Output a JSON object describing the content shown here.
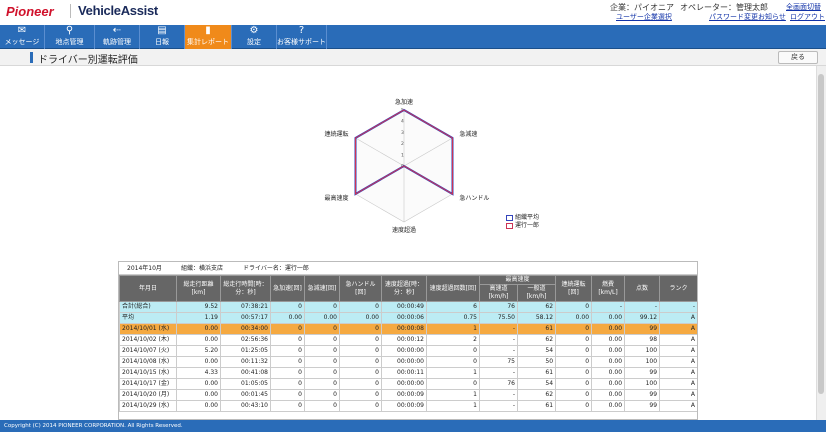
{
  "header": {
    "logo_pioneer": "Pioneer",
    "logo_vehicle": "VehicleAssist",
    "company_label": "企業：パイオニア",
    "operator_label": "オペレーター：管理太郎",
    "links": {
      "switch_user_company": "ユーザー企業選択",
      "change_password": "パスワード変更",
      "fullscreen_toggle": "全画面切替",
      "notices": "お知らせ",
      "logout": "ログアウト"
    }
  },
  "nav": {
    "items": [
      {
        "label": "メッセージ",
        "icon": "✉"
      },
      {
        "label": "地点管理",
        "icon": "⚲"
      },
      {
        "label": "軌跡管理",
        "icon": "⇠"
      },
      {
        "label": "日報",
        "icon": "▤"
      },
      {
        "label": "集計レポート",
        "icon": "▮"
      },
      {
        "label": "設定",
        "icon": "⚙"
      },
      {
        "label": "お客様サポート",
        "icon": "?"
      }
    ],
    "active_index": 4
  },
  "page": {
    "title": "ドライバー別運転評価",
    "back_label": "戻る"
  },
  "chart_data": {
    "type": "radar",
    "axes": [
      "急加速",
      "急減速",
      "急ハンドル",
      "速度超過",
      "最高速度",
      "連続運転"
    ],
    "rlim": [
      0,
      5
    ],
    "ticks": [
      "0",
      "1",
      "2",
      "3",
      "4",
      "5"
    ],
    "series": [
      {
        "name": "組織平均",
        "values": [
          5,
          5,
          5,
          0,
          5,
          5
        ],
        "color": "#3344bb"
      },
      {
        "name": "運行一郎",
        "values": [
          5,
          5,
          5,
          0,
          5,
          5
        ],
        "color": "#cc3355"
      }
    ],
    "legend": "right"
  },
  "report": {
    "month": "2014年10月",
    "org": "組織：横浜支店",
    "driver": "ドライバー名：運行一郎",
    "columns": {
      "date": "年月日",
      "distance": "総走行距離[km]",
      "drive_time": "総走行時間[時：分：秒]",
      "hard_accel": "急加速[回]",
      "hard_decel": "急減速[回]",
      "hard_turn": "急ハンドル[回]",
      "overspeed_time": "速度超過[時：分：秒]",
      "overspeed_count": "速度超過回数[回]",
      "max_speed": "最高速度",
      "max_highway": "高速道[km/h]",
      "max_local": "一般道[km/h]",
      "continuous": "連続運転[回]",
      "fuel": "燃費[km/L]",
      "score": "点数",
      "rank": "ランク"
    },
    "rows": [
      {
        "date": "合計(総合)",
        "distance": "9.52",
        "time": "07:38:21",
        "accel": "0",
        "decel": "0",
        "turn": "0",
        "otime": "00:00:49",
        "ocount": "6",
        "hw": "76",
        "local": "62",
        "cont": "0",
        "fuel": "-",
        "score": "-",
        "rank": "-",
        "kind": "sum"
      },
      {
        "date": "平均",
        "distance": "1.19",
        "time": "00:57:17",
        "accel": "0.00",
        "decel": "0.00",
        "turn": "0.00",
        "otime": "00:00:06",
        "ocount": "0.75",
        "hw": "75.50",
        "local": "58.12",
        "cont": "0.00",
        "fuel": "0.00",
        "score": "99.12",
        "rank": "A",
        "kind": "sum"
      },
      {
        "date": "2014/10/01 (水)",
        "distance": "0.00",
        "time": "00:34:00",
        "accel": "0",
        "decel": "0",
        "turn": "0",
        "otime": "00:00:08",
        "ocount": "1",
        "hw": "-",
        "local": "61",
        "cont": "0",
        "fuel": "0.00",
        "score": "99",
        "rank": "A",
        "kind": "sel"
      },
      {
        "date": "2014/10/02 (木)",
        "distance": "0.00",
        "time": "02:56:36",
        "accel": "0",
        "decel": "0",
        "turn": "0",
        "otime": "00:00:12",
        "ocount": "2",
        "hw": "-",
        "local": "62",
        "cont": "0",
        "fuel": "0.00",
        "score": "98",
        "rank": "A",
        "kind": ""
      },
      {
        "date": "2014/10/07 (火)",
        "distance": "5.20",
        "time": "01:25:05",
        "accel": "0",
        "decel": "0",
        "turn": "0",
        "otime": "00:00:00",
        "ocount": "0",
        "hw": "-",
        "local": "54",
        "cont": "0",
        "fuel": "0.00",
        "score": "100",
        "rank": "A",
        "kind": ""
      },
      {
        "date": "2014/10/08 (水)",
        "distance": "0.00",
        "time": "00:11:32",
        "accel": "0",
        "decel": "0",
        "turn": "0",
        "otime": "00:00:00",
        "ocount": "0",
        "hw": "75",
        "local": "50",
        "cont": "0",
        "fuel": "0.00",
        "score": "100",
        "rank": "A",
        "kind": ""
      },
      {
        "date": "2014/10/15 (水)",
        "distance": "4.33",
        "time": "00:41:08",
        "accel": "0",
        "decel": "0",
        "turn": "0",
        "otime": "00:00:11",
        "ocount": "1",
        "hw": "-",
        "local": "61",
        "cont": "0",
        "fuel": "0.00",
        "score": "99",
        "rank": "A",
        "kind": ""
      },
      {
        "date": "2014/10/17 (金)",
        "distance": "0.00",
        "time": "01:05:05",
        "accel": "0",
        "decel": "0",
        "turn": "0",
        "otime": "00:00:00",
        "ocount": "0",
        "hw": "76",
        "local": "54",
        "cont": "0",
        "fuel": "0.00",
        "score": "100",
        "rank": "A",
        "kind": ""
      },
      {
        "date": "2014/10/20 (月)",
        "distance": "0.00",
        "time": "00:01:45",
        "accel": "0",
        "decel": "0",
        "turn": "0",
        "otime": "00:00:09",
        "ocount": "1",
        "hw": "-",
        "local": "62",
        "cont": "0",
        "fuel": "0.00",
        "score": "99",
        "rank": "A",
        "kind": ""
      },
      {
        "date": "2014/10/29 (水)",
        "distance": "0.00",
        "time": "00:43:10",
        "accel": "0",
        "decel": "0",
        "turn": "0",
        "otime": "00:00:09",
        "ocount": "1",
        "hw": "-",
        "local": "61",
        "cont": "0",
        "fuel": "0.00",
        "score": "99",
        "rank": "A",
        "kind": ""
      }
    ]
  },
  "footer": {
    "copyright": "Copyright (C) 2014 PIONEER CORPORATION. All Rights Reserved."
  }
}
